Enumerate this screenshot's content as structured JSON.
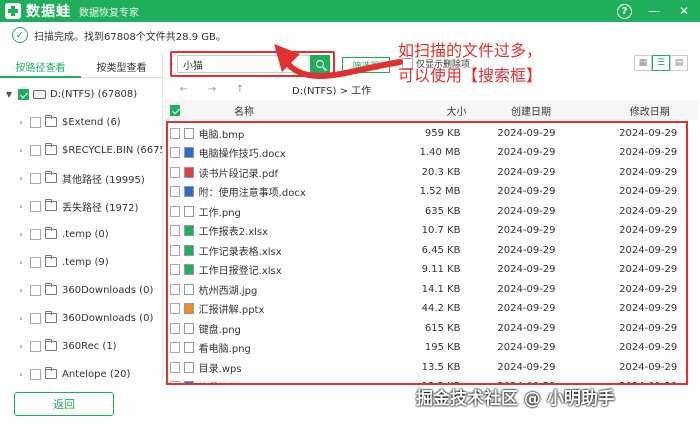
{
  "app": {
    "name": "数据蛙",
    "subtitle": "数据恢复专家"
  },
  "window": {
    "help": "?",
    "minimize": "—",
    "close": "✕"
  },
  "status": {
    "text": "扫描完成。找到67808个文件共28.9 GB。"
  },
  "tabs": [
    {
      "label": "按路径查看"
    },
    {
      "label": "按类型查看"
    }
  ],
  "tree": [
    {
      "label": "D:(NTFS) (67808)",
      "expanded": true,
      "checked": true
    },
    {
      "label": "$Extend (6)",
      "expanded": false,
      "checked": false
    },
    {
      "label": "$RECYCLE.BIN (6675)",
      "expanded": false,
      "checked": false
    },
    {
      "label": "其他路径 (19995)",
      "expanded": false,
      "checked": false
    },
    {
      "label": "丢失路径 (1972)",
      "expanded": false,
      "checked": false
    },
    {
      "label": ".temp (0)",
      "expanded": false,
      "checked": false
    },
    {
      "label": ".temp (9)",
      "expanded": false,
      "checked": false
    },
    {
      "label": "360Downloads (0)",
      "expanded": false,
      "checked": false
    },
    {
      "label": "360Downloads (0)",
      "expanded": false,
      "checked": false
    },
    {
      "label": "360Rec (1)",
      "expanded": false,
      "checked": false
    },
    {
      "label": "Antelope (20)",
      "expanded": false,
      "checked": false
    }
  ],
  "back_button": "返回",
  "search": {
    "value": "小猫"
  },
  "filter_button": "筛选器",
  "only_deleted": "仅显示删除项",
  "annotation": {
    "line1": "如扫描的文件过多，",
    "line2": "可以使用【搜索框】"
  },
  "breadcrumb": "D:(NTFS) > 工作",
  "table": {
    "columns": {
      "name": "名称",
      "size": "大小",
      "created": "创建日期",
      "modified": "修改日期"
    },
    "rows": [
      {
        "name": "电脑.bmp",
        "size": "959 KB",
        "created": "2024-09-29",
        "modified": "2024-09-29",
        "icon": "image-file-icon",
        "color": "#ffffff"
      },
      {
        "name": "电脑操作技巧.docx",
        "size": "1.40 MB",
        "created": "2024-09-29",
        "modified": "2024-09-29",
        "icon": "word-file-icon",
        "color": "#2b6cd0"
      },
      {
        "name": "读书片段记录.pdf",
        "size": "20.3 KB",
        "created": "2024-09-29",
        "modified": "2024-09-29",
        "icon": "pdf-file-icon",
        "color": "#e04040"
      },
      {
        "name": "附：使用注意事项.docx",
        "size": "1.52 MB",
        "created": "2024-09-29",
        "modified": "2024-09-29",
        "icon": "word-file-icon",
        "color": "#2b6cd0"
      },
      {
        "name": "工作.png",
        "size": "635 KB",
        "created": "2024-09-29",
        "modified": "2024-09-29",
        "icon": "image-file-icon",
        "color": "#ffffff"
      },
      {
        "name": "工作报表2.xlsx",
        "size": "10.7 KB",
        "created": "2024-09-29",
        "modified": "2024-09-29",
        "icon": "excel-file-icon",
        "color": "#1fae5b"
      },
      {
        "name": "工作记录表格.xlsx",
        "size": "6.45 KB",
        "created": "2024-09-29",
        "modified": "2024-09-29",
        "icon": "excel-file-icon",
        "color": "#1fae5b"
      },
      {
        "name": "工作日报登记.xlsx",
        "size": "9.11 KB",
        "created": "2024-09-29",
        "modified": "2024-09-29",
        "icon": "excel-file-icon",
        "color": "#1fae5b"
      },
      {
        "name": "杭州西湖.jpg",
        "size": "14.1 KB",
        "created": "2024-09-29",
        "modified": "2024-09-29",
        "icon": "image-file-icon",
        "color": "#ffffff"
      },
      {
        "name": "汇报讲解.pptx",
        "size": "44.2 KB",
        "created": "2024-09-29",
        "modified": "2024-09-29",
        "icon": "ppt-file-icon",
        "color": "#f08a24"
      },
      {
        "name": "键盘.png",
        "size": "615 KB",
        "created": "2024-09-29",
        "modified": "2024-09-29",
        "icon": "image-file-icon",
        "color": "#ffffff"
      },
      {
        "name": "看电脑.png",
        "size": "195 KB",
        "created": "2024-09-29",
        "modified": "2024-09-29",
        "icon": "image-file-icon",
        "color": "#ffffff"
      },
      {
        "name": "目录.wps",
        "size": "13.5 KB",
        "created": "2024-09-29",
        "modified": "2024-09-29",
        "icon": "wps-file-icon",
        "color": "#ffffff"
      },
      {
        "name": "片段记录.docx",
        "size": "13.2 KB",
        "created": "2024-09-29",
        "modified": "2024-09-29",
        "icon": "word-file-icon",
        "color": "#2b6cd0"
      }
    ]
  },
  "watermark": "掘金技术社区 @ 小明助手",
  "colors": {
    "accent": "#1fae5b",
    "highlight": "#e03030"
  }
}
